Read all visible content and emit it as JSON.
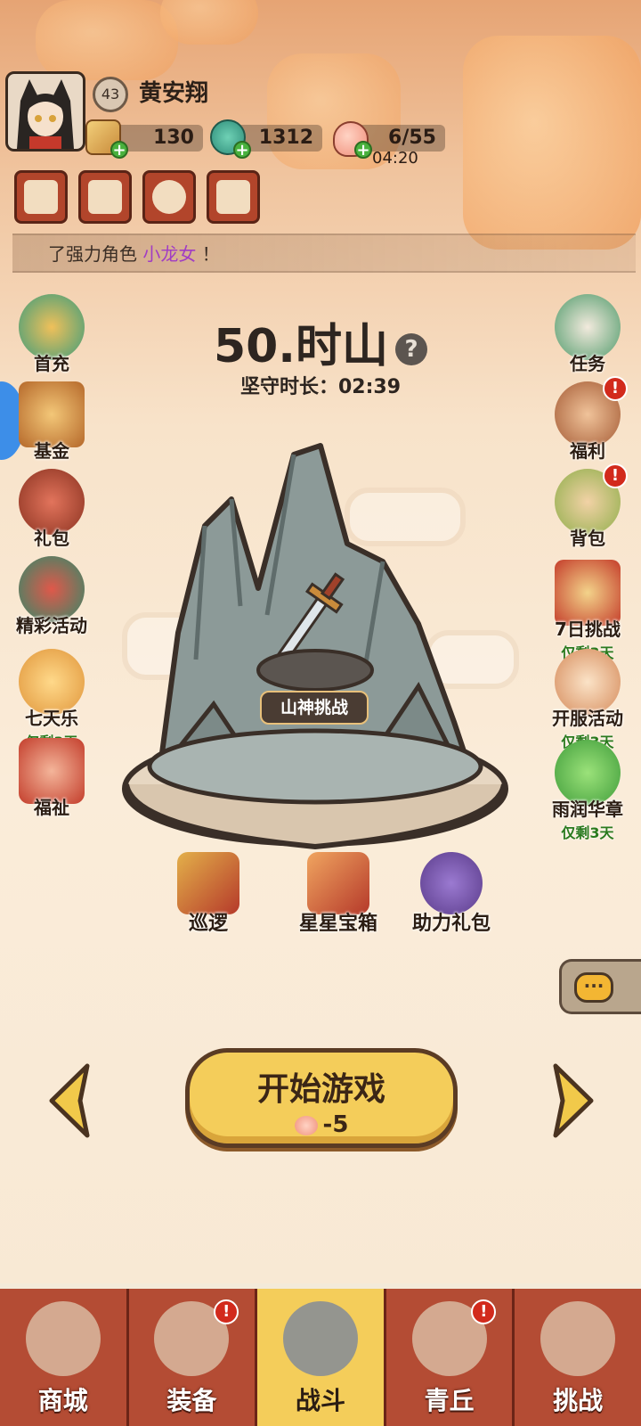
{
  "player": {
    "level": "43",
    "name": "黄安翔"
  },
  "resources": [
    {
      "name": "ticket",
      "value": "130",
      "icon": "ticket-icon"
    },
    {
      "name": "jade",
      "value": "1312",
      "icon": "jade-fish-icon"
    },
    {
      "name": "stamina",
      "value": "6/55",
      "icon": "peach-icon",
      "timer": "04:20"
    }
  ],
  "toolbar": [
    {
      "icon": "cards-icon"
    },
    {
      "icon": "ranking-icon"
    },
    {
      "icon": "settings-gear-icon"
    },
    {
      "icon": "friends-icon"
    }
  ],
  "ticker": {
    "prefix": "了强力角色",
    "highlight": "小龙女",
    "suffix": "！"
  },
  "left_menu": [
    {
      "label": "首充",
      "icon": "first-charge-chest-icon"
    },
    {
      "label": "基金",
      "icon": "fund-icon"
    },
    {
      "label": "礼包",
      "icon": "gift-bag-icon"
    },
    {
      "label": "精彩活动",
      "icon": "dragon-event-icon"
    },
    {
      "label": "七天乐",
      "sub": "仅剩3天",
      "icon": "lantern-icon"
    },
    {
      "label": "福祉",
      "icon": "gift-box-icon"
    }
  ],
  "right_menu": [
    {
      "label": "任务",
      "icon": "scroll-task-icon"
    },
    {
      "label": "福利",
      "icon": "welfare-pot-icon",
      "badge": "!"
    },
    {
      "label": "背包",
      "icon": "backpack-icon",
      "badge": "!"
    },
    {
      "label": "7日挑战",
      "sub": "仅剩3天",
      "icon": "seven-day-scroll-icon"
    },
    {
      "label": "开服活动",
      "sub": "仅剩3天",
      "icon": "server-event-icon"
    },
    {
      "label": "雨润华章",
      "sub": "仅剩3天",
      "icon": "green-leaves-icon"
    }
  ],
  "stage": {
    "title": "50.时山",
    "help": "?",
    "duration_label": "坚守时长：",
    "duration": "02:39",
    "boss_label": "山神挑战"
  },
  "stage_actions": [
    {
      "label": "巡逻",
      "icon": "patrol-flag-icon"
    },
    {
      "label": "星星宝箱",
      "icon": "star-chest-icon"
    },
    {
      "label": "助力礼包",
      "icon": "assist-bag-icon"
    }
  ],
  "start": {
    "label": "开始游戏",
    "cost": "-5"
  },
  "chat": {
    "icon": "chat-bubble-icon",
    "glyph": "···"
  },
  "nav": [
    {
      "label": "商城",
      "icon": "shop-icon"
    },
    {
      "label": "装备",
      "icon": "helmet-icon",
      "badge": "!"
    },
    {
      "label": "战斗",
      "icon": "crossed-swords-icon",
      "active": true
    },
    {
      "label": "青丘",
      "icon": "mountain-icon",
      "badge": "!"
    },
    {
      "label": "挑战",
      "icon": "challenge-orb-icon"
    }
  ]
}
